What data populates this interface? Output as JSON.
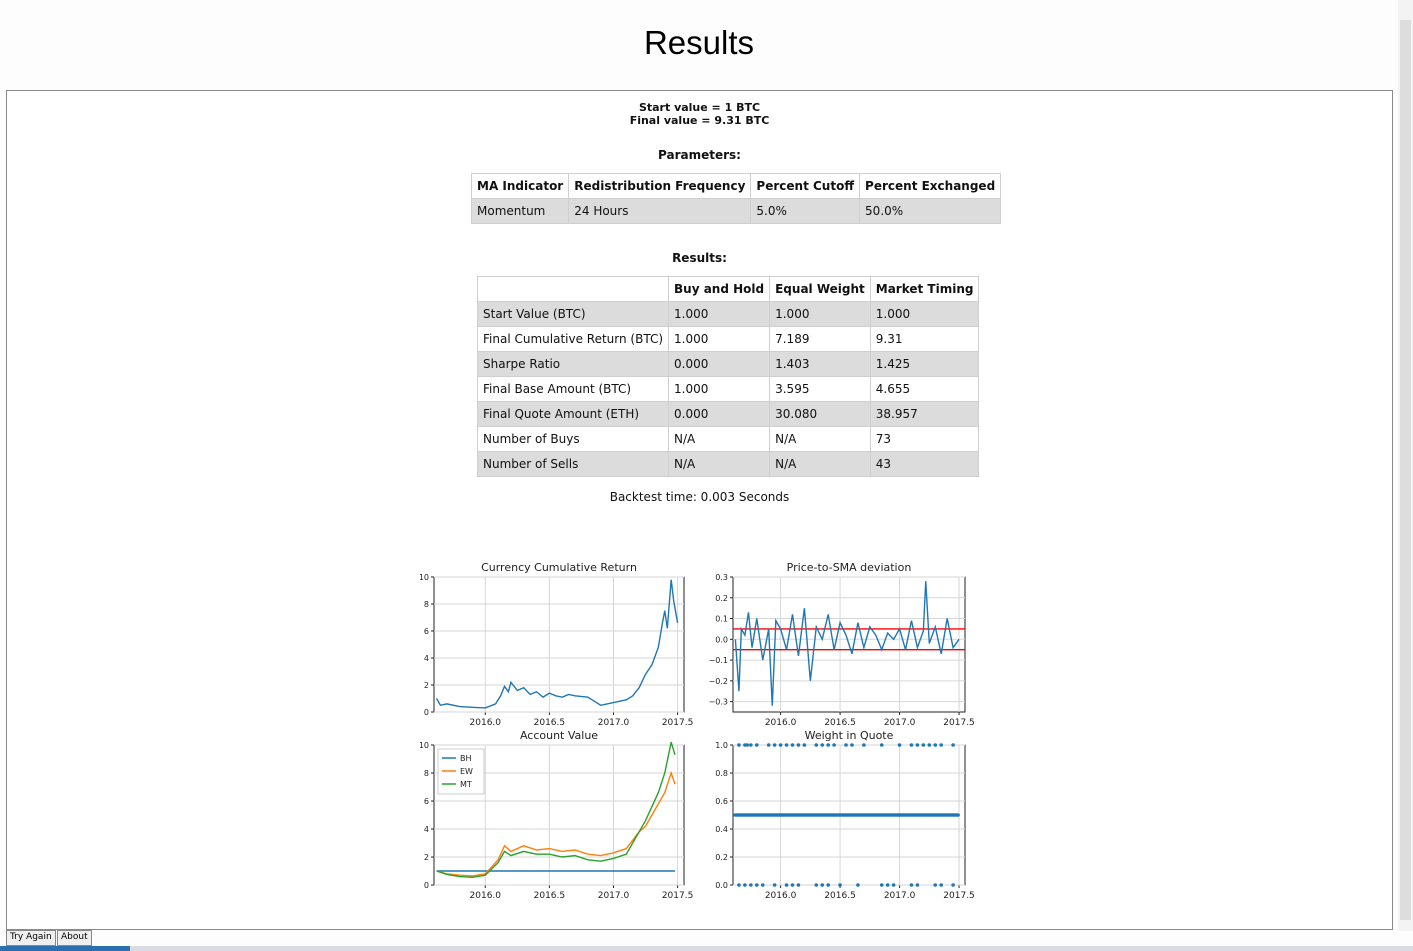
{
  "window": {
    "title": "Results"
  },
  "summary": {
    "start_value": "Start value = 1 BTC",
    "final_value": "Final value = 9.31 BTC"
  },
  "parameters": {
    "heading": "Parameters:",
    "headers": [
      "MA Indicator",
      "Redistribution Frequency",
      "Percent Cutoff",
      "Percent Exchanged"
    ],
    "row": [
      "Momentum",
      "24 Hours",
      "5.0%",
      "50.0%"
    ]
  },
  "results": {
    "heading": "Results:",
    "headers": [
      "",
      "Buy and Hold",
      "Equal Weight",
      "Market Timing"
    ],
    "rows": [
      [
        "Start Value (BTC)",
        "1.000",
        "1.000",
        "1.000"
      ],
      [
        "Final Cumulative Return (BTC)",
        "1.000",
        "7.189",
        "9.31"
      ],
      [
        "Sharpe Ratio",
        "0.000",
        "1.403",
        "1.425"
      ],
      [
        "Final Base Amount (BTC)",
        "1.000",
        "3.595",
        "4.655"
      ],
      [
        "Final Quote Amount (ETH)",
        "0.000",
        "30.080",
        "38.957"
      ],
      [
        "Number of Buys",
        "N/A",
        "N/A",
        "73"
      ],
      [
        "Number of Sells",
        "N/A",
        "N/A",
        "43"
      ]
    ]
  },
  "backtest_time": "Backtest time: 0.003 Seconds",
  "buttons": {
    "try_again": "Try Again",
    "about": "About"
  },
  "chart_data": [
    {
      "type": "line",
      "title": "Currency Cumulative Return",
      "xlim": [
        2015.6,
        2017.55
      ],
      "ylim": [
        0,
        10
      ],
      "xticks": [
        "2016.0",
        "2016.5",
        "2017.0",
        "2017.5"
      ],
      "yticks": [
        "0",
        "2",
        "4",
        "6",
        "8",
        "10"
      ],
      "grid": true,
      "series": [
        {
          "color": "#1f77b4",
          "x": [
            2015.62,
            2015.65,
            2015.7,
            2015.8,
            2015.9,
            2016.0,
            2016.08,
            2016.12,
            2016.15,
            2016.18,
            2016.2,
            2016.25,
            2016.3,
            2016.35,
            2016.4,
            2016.45,
            2016.5,
            2016.55,
            2016.6,
            2016.65,
            2016.7,
            2016.8,
            2016.85,
            2016.9,
            2016.95,
            2017.0,
            2017.05,
            2017.1,
            2017.15,
            2017.2,
            2017.25,
            2017.3,
            2017.35,
            2017.38,
            2017.4,
            2017.42,
            2017.45,
            2017.47,
            2017.5
          ],
          "y": [
            1.0,
            0.5,
            0.6,
            0.4,
            0.35,
            0.3,
            0.6,
            1.2,
            1.9,
            1.5,
            2.2,
            1.6,
            1.8,
            1.3,
            1.5,
            1.1,
            1.4,
            1.2,
            1.1,
            1.3,
            1.2,
            1.1,
            0.8,
            0.5,
            0.6,
            0.7,
            0.8,
            0.9,
            1.2,
            1.8,
            2.8,
            3.5,
            4.8,
            6.5,
            7.5,
            6.2,
            9.8,
            8.2,
            6.6
          ]
        }
      ]
    },
    {
      "type": "line",
      "title": "Price-to-SMA deviation",
      "xlim": [
        2015.6,
        2017.55
      ],
      "ylim": [
        -0.35,
        0.3
      ],
      "xticks": [
        "2016.0",
        "2016.5",
        "2017.0",
        "2017.5"
      ],
      "yticks": [
        "0.3",
        "0.2",
        "0.1",
        "0.0",
        "−0.1",
        "−0.2",
        "−0.3"
      ],
      "grid": true,
      "hlines": [
        0.05,
        -0.05
      ],
      "hline_color": "#ff0000",
      "series": [
        {
          "color": "#1f77b4",
          "x": [
            2015.62,
            2015.65,
            2015.67,
            2015.7,
            2015.73,
            2015.76,
            2015.8,
            2015.85,
            2015.9,
            2015.93,
            2015.96,
            2016.0,
            2016.05,
            2016.1,
            2016.15,
            2016.2,
            2016.25,
            2016.3,
            2016.35,
            2016.4,
            2016.45,
            2016.5,
            2016.55,
            2016.6,
            2016.65,
            2016.7,
            2016.75,
            2016.8,
            2016.85,
            2016.9,
            2016.95,
            2017.0,
            2017.05,
            2017.1,
            2017.15,
            2017.2,
            2017.22,
            2017.25,
            2017.3,
            2017.35,
            2017.4,
            2017.45,
            2017.5
          ],
          "y": [
            0.0,
            -0.25,
            0.05,
            0.02,
            0.13,
            -0.04,
            0.1,
            -0.1,
            0.05,
            -0.32,
            0.09,
            0.05,
            -0.05,
            0.12,
            -0.08,
            0.15,
            -0.2,
            0.06,
            0.0,
            0.12,
            -0.05,
            0.08,
            0.02,
            -0.07,
            0.08,
            -0.04,
            0.06,
            0.02,
            -0.05,
            0.03,
            0.0,
            0.05,
            -0.05,
            0.09,
            -0.04,
            0.04,
            0.28,
            -0.02,
            0.06,
            -0.07,
            0.1,
            -0.04,
            0.0
          ]
        }
      ]
    },
    {
      "type": "line",
      "title": "Account Value",
      "xlim": [
        2015.6,
        2017.55
      ],
      "ylim": [
        0,
        10
      ],
      "xticks": [
        "2016.0",
        "2016.5",
        "2017.0",
        "2017.5"
      ],
      "yticks": [
        "0",
        "2",
        "4",
        "6",
        "8",
        "10"
      ],
      "grid": true,
      "legend": "top-left",
      "series": [
        {
          "name": "BH",
          "color": "#1f77b4",
          "x": [
            2015.62,
            2017.48
          ],
          "y": [
            1.0,
            1.0
          ]
        },
        {
          "name": "EW",
          "color": "#ff7f0e",
          "x": [
            2015.62,
            2015.7,
            2015.8,
            2015.9,
            2016.0,
            2016.1,
            2016.15,
            2016.2,
            2016.3,
            2016.4,
            2016.5,
            2016.6,
            2016.7,
            2016.8,
            2016.9,
            2017.0,
            2017.1,
            2017.2,
            2017.25,
            2017.3,
            2017.35,
            2017.4,
            2017.45,
            2017.48
          ],
          "y": [
            1.0,
            0.8,
            0.7,
            0.65,
            0.8,
            1.8,
            2.8,
            2.4,
            2.8,
            2.5,
            2.6,
            2.4,
            2.5,
            2.2,
            2.1,
            2.3,
            2.6,
            3.8,
            4.2,
            5.0,
            5.8,
            6.6,
            8.0,
            7.2
          ]
        },
        {
          "name": "MT",
          "color": "#2ca02c",
          "x": [
            2015.62,
            2015.7,
            2015.8,
            2015.9,
            2016.0,
            2016.1,
            2016.15,
            2016.2,
            2016.3,
            2016.4,
            2016.5,
            2016.6,
            2016.7,
            2016.8,
            2016.9,
            2017.0,
            2017.1,
            2017.2,
            2017.25,
            2017.3,
            2017.35,
            2017.4,
            2017.45,
            2017.48
          ],
          "y": [
            1.0,
            0.75,
            0.6,
            0.55,
            0.7,
            1.6,
            2.4,
            2.1,
            2.4,
            2.2,
            2.2,
            2.0,
            2.1,
            1.8,
            1.7,
            1.9,
            2.2,
            3.8,
            4.6,
            5.6,
            6.6,
            8.0,
            10.2,
            9.3
          ]
        }
      ]
    },
    {
      "type": "scatter",
      "title": "Weight in Quote",
      "xlim": [
        2015.6,
        2017.55
      ],
      "ylim": [
        0,
        1.0
      ],
      "xticks": [
        "2016.0",
        "2016.5",
        "2017.0",
        "2017.5"
      ],
      "yticks": [
        "1.0",
        "0.8",
        "0.6",
        "0.4",
        "0.2",
        "0.0"
      ],
      "grid": true,
      "series": [
        {
          "color": "#1f77b4",
          "points_y": [
            0.0,
            0.5,
            1.0
          ],
          "x_at_1": [
            2015.65,
            2015.7,
            2015.72,
            2015.75,
            2015.8,
            2015.9,
            2015.95,
            2016.0,
            2016.05,
            2016.1,
            2016.15,
            2016.2,
            2016.3,
            2016.35,
            2016.4,
            2016.45,
            2016.55,
            2016.6,
            2016.7,
            2016.85,
            2017.0,
            2017.1,
            2017.15,
            2017.2,
            2017.25,
            2017.3,
            2017.35,
            2017.45
          ],
          "x_at_0": [
            2015.65,
            2015.7,
            2015.75,
            2015.8,
            2015.85,
            2015.95,
            2016.05,
            2016.1,
            2016.15,
            2016.3,
            2016.35,
            2016.4,
            2016.5,
            2016.65,
            2016.85,
            2016.9,
            2016.95,
            2017.1,
            2017.15,
            2017.3,
            2017.35,
            2017.45
          ]
        }
      ]
    }
  ]
}
